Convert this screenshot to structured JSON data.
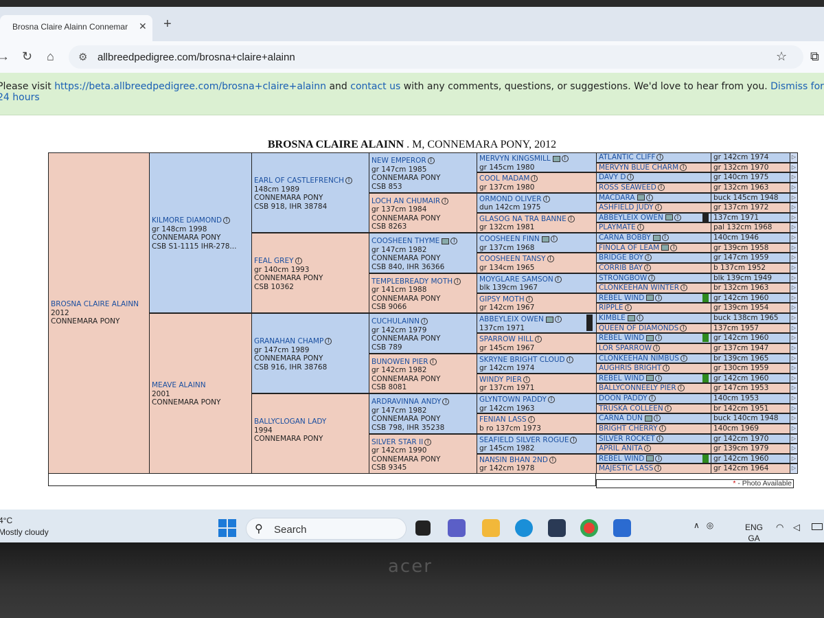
{
  "browser": {
    "tab_title": "Brosna Claire Alainn Connemar",
    "tab_close": "✕",
    "new_tab": "+",
    "url": "allbreedpedigree.com/brosna+claire+alainn"
  },
  "banner": {
    "text1": "Please visit ",
    "link1": "https://beta.allbreedpedigree.com/brosna+claire+alainn",
    "text2": " and ",
    "link2": "contact us",
    "text3": " with any comments, questions, or suggestions. We'd love to hear from you. ",
    "link3": "Dismiss for 24 hours"
  },
  "page": {
    "title_bold": "BROSNA CLAIRE ALAINN",
    "title_rest": " . M, CONNEMARA PONY, 2012"
  },
  "gen1": {
    "name": "BROSNA CLAIRE ALAINN",
    "l1": "2012",
    "l2": "CONNEMARA PONY"
  },
  "gen2": [
    {
      "name": "KILMORE DIAMOND",
      "l1": "gr 148cm 1998",
      "l2": "CONNEMARA PONY",
      "l3": "CSB S1-1115 IHR-278..."
    },
    {
      "name": "MEAVE ALAINN",
      "l1": "2001",
      "l2": "CONNEMARA PONY"
    }
  ],
  "gen3": [
    {
      "name": "EARL OF CASTLEFRENCH",
      "l1": "148cm 1989",
      "l2": "CONNEMARA PONY",
      "l3": "CSB 918, IHR 38784"
    },
    {
      "name": "FEAL GREY",
      "l1": "gr 140cm 1993",
      "l2": "CONNEMARA PONY",
      "l3": "CSB 10362"
    },
    {
      "name": "GRANAHAN CHAMP",
      "l1": "gr 147cm 1989",
      "l2": "CONNEMARA PONY",
      "l3": "CSB 916, IHR 38768"
    },
    {
      "name": "BALLYCLOGAN LADY",
      "l1": "1994",
      "l2": "CONNEMARA PONY",
      "l3": ""
    }
  ],
  "gen4": [
    {
      "name": "NEW EMPEROR",
      "l1": "gr 147cm 1985",
      "l2": "CONNEMARA PONY",
      "l3": "CSB 853"
    },
    {
      "name": "LOCH AN CHUMAIR",
      "l1": "gr 137cm 1984",
      "l2": "CONNEMARA PONY",
      "l3": "CSB 8263"
    },
    {
      "name": "COOSHEEN THYME",
      "l1": "gr 147cm 1982",
      "l2": "CONNEMARA PONY",
      "l3": "CSB 840, IHR 36366"
    },
    {
      "name": "TEMPLEBREADY MOTH",
      "l1": "gr 141cm 1988",
      "l2": "CONNEMARA PONY",
      "l3": "CSB 9066"
    },
    {
      "name": "CUCHULAINN",
      "l1": "gr 142cm 1979",
      "l2": "CONNEMARA PONY",
      "l3": "CSB 789"
    },
    {
      "name": "BUNOWEN PIER",
      "l1": "gr 142cm 1982",
      "l2": "CONNEMARA PONY",
      "l3": "CSB 8081"
    },
    {
      "name": "ARDRAVINNA ANDY",
      "l1": "gr 147cm 1982",
      "l2": "CONNEMARA PONY",
      "l3": "CSB 798, IHR 35238"
    },
    {
      "name": "SILVER STAR II",
      "l1": "gr 142cm 1990",
      "l2": "CONNEMARA PONY",
      "l3": "CSB 9345"
    }
  ],
  "gen5": [
    {
      "name": "MERVYN KINGSMILL",
      "l1": "gr 145cm 1980"
    },
    {
      "name": "COOL MADAM",
      "l1": "gr 137cm 1980"
    },
    {
      "name": "ORMOND OLIVER",
      "l1": "dun 142cm 1975"
    },
    {
      "name": "GLASOG NA TRA BANNE",
      "l1": "gr 132cm 1981"
    },
    {
      "name": "COOSHEEN FINN",
      "l1": "gr 137cm 1968"
    },
    {
      "name": "COOSHEEN TANSY",
      "l1": "gr 134cm 1965"
    },
    {
      "name": "MOYGLARE SAMSON",
      "l1": "blk 139cm 1967"
    },
    {
      "name": "GIPSY MOTH",
      "l1": "gr 142cm 1967"
    },
    {
      "name": "ABBEYLEIX OWEN",
      "l1": "137cm 1971"
    },
    {
      "name": "SPARROW HILL",
      "l1": "gr 145cm 1967"
    },
    {
      "name": "SKRYNE BRIGHT CLOUD",
      "l1": "gr 142cm 1974"
    },
    {
      "name": "WINDY PIER",
      "l1": "gr 137cm 1971"
    },
    {
      "name": "GLYNTOWN PADDY",
      "l1": "gr 142cm 1963"
    },
    {
      "name": "FENIAN LASS",
      "l1": "b ro 137cm 1973"
    },
    {
      "name": "SEAFIELD SILVER ROGUE",
      "l1": "gr 145cm 1982"
    },
    {
      "name": "NANSIN BHAN 2ND",
      "l1": "gr 142cm 1978"
    }
  ],
  "gen6": [
    {
      "name": "ATLANTIC CLIFF",
      "d": "gr 142cm 1974"
    },
    {
      "name": "MERVYN BLUE CHARM",
      "d": "gr 132cm 1970"
    },
    {
      "name": "DAVY D",
      "d": "gr 140cm 1975"
    },
    {
      "name": "ROSS SEAWEED",
      "d": "gr 132cm 1963"
    },
    {
      "name": "MACDARA",
      "d": "buck 145cm 1948"
    },
    {
      "name": "ASHFIELD JUDY",
      "d": "gr 137cm 1972"
    },
    {
      "name": "ABBEYLEIX OWEN",
      "d": "137cm 1971"
    },
    {
      "name": "PLAYMATE",
      "d": "pal 132cm 1968"
    },
    {
      "name": "CARNA BOBBY",
      "d": "140cm 1946"
    },
    {
      "name": "FINOLA OF LEAM",
      "d": "gr 139cm 1958"
    },
    {
      "name": "BRIDGE BOY",
      "d": "gr 147cm 1959"
    },
    {
      "name": "CORRIB BAY",
      "d": "b 137cm 1952"
    },
    {
      "name": "STRONGBOW",
      "d": "blk 139cm 1949"
    },
    {
      "name": "CLONKEEHAN WINTER",
      "d": "br 132cm 1963"
    },
    {
      "name": "REBEL WIND",
      "d": "gr 142cm 1960"
    },
    {
      "name": "RIPPLE",
      "d": "gr 139cm 1954"
    },
    {
      "name": "KIMBLE",
      "d": "buck 138cm 1965"
    },
    {
      "name": "QUEEN OF DIAMONDS",
      "d": "137cm 1957"
    },
    {
      "name": "REBEL WIND",
      "d": "gr 142cm 1960"
    },
    {
      "name": "LOR SPARROW",
      "d": "gr 137cm 1947"
    },
    {
      "name": "CLONKEEHAN NIMBUS",
      "d": "br 139cm 1965"
    },
    {
      "name": "AUGHRIS BRIGHT",
      "d": "gr 130cm 1959"
    },
    {
      "name": "REBEL WIND",
      "d": "gr 142cm 1960"
    },
    {
      "name": "BALLYCONNEELY PIER",
      "d": "gr 147cm 1953"
    },
    {
      "name": "DOON PADDY",
      "d": "140cm 1953"
    },
    {
      "name": "TRUSKA COLLEEN",
      "d": "br 142cm 1951"
    },
    {
      "name": "CARNA DUN",
      "d": "buck 140cm 1948"
    },
    {
      "name": "BRIGHT CHERRY",
      "d": "140cm 1969"
    },
    {
      "name": "SILVER ROCKET",
      "d": "gr 142cm 1970"
    },
    {
      "name": "APRIL ANITA",
      "d": "gr 139cm 1979"
    },
    {
      "name": "REBEL WIND",
      "d": "gr 142cm 1960"
    },
    {
      "name": "MAJESTIC LASS",
      "d": "gr 142cm 1964"
    }
  ],
  "footer": {
    "star": "*",
    "note": " - Photo Available"
  },
  "taskbar": {
    "weather_temp": "4°C",
    "weather_desc": "Mostly cloudy",
    "search_placeholder": "Search",
    "lang1": "ENG",
    "lang2": "GA"
  },
  "colors": {
    "male": "#bcd1ee",
    "female": "#f0cdbf",
    "link": "#1a4fa0"
  },
  "icons": [
    "back-icon",
    "reload-icon",
    "home-icon",
    "star-icon",
    "info-icon",
    "camera-icon",
    "windows-icon",
    "search-icon"
  ]
}
